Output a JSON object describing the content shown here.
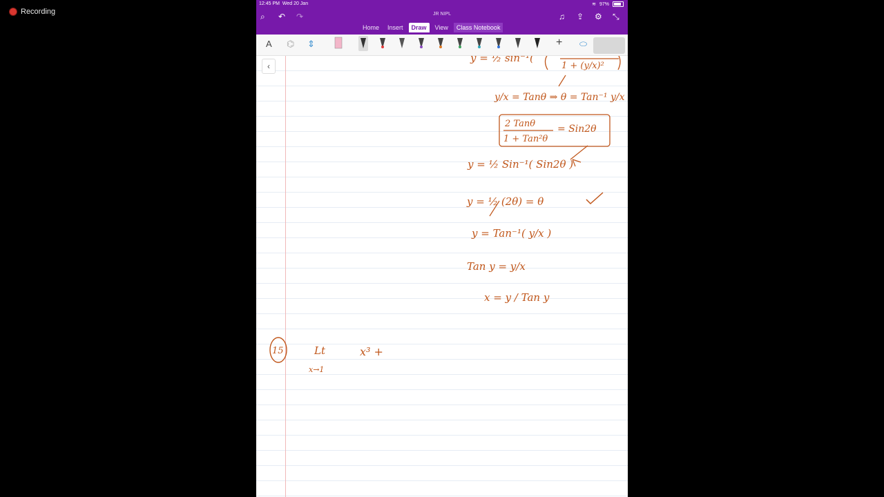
{
  "recording": {
    "label": "Recording"
  },
  "status": {
    "time": "12:45 PM",
    "date": "Wed 20 Jan",
    "battery": "97%"
  },
  "app": {
    "title": "JR NIPL"
  },
  "tabs": [
    {
      "label": "Home"
    },
    {
      "label": "Insert"
    },
    {
      "label": "Draw"
    },
    {
      "label": "View"
    },
    {
      "label": "Class Notebook"
    }
  ],
  "colors": {
    "brand": "#7719aa",
    "ink": "#c0561a",
    "margin": "#f0b8b8"
  },
  "icons": {
    "status": [
      "search-icon",
      "undo-icon",
      "redo-icon",
      "bell-icon",
      "share-icon",
      "settings-icon",
      "collapse-icon"
    ],
    "toolbar": [
      "text-icon",
      "lasso-icon",
      "ruler-icon",
      "eraser-icon",
      "add-pen-icon",
      "shapes-icon",
      "back-chevron-icon"
    ]
  },
  "ink": {
    "l1": "y = ½ sin⁻¹(",
    "l1b": "1 + (y/x)²",
    "l2": "y/x = Tanθ ⇒ θ = Tan⁻¹ y/x",
    "l3a": "2 Tanθ",
    "l3b": "1 + Tan²θ",
    "l3c": "= Sin2θ",
    "l4": "y = ½ Sin⁻¹( Sin2θ )",
    "l5": "y = ½ (2θ) = θ",
    "l6": "y =   Tan⁻¹( y/x )",
    "l7": "Tan y  =  y/x",
    "l8": "x  =   y / Tan y",
    "q_num": "15",
    "q_lt": "Lt",
    "q_sub": "x→1",
    "q_expr": "x³ +"
  }
}
